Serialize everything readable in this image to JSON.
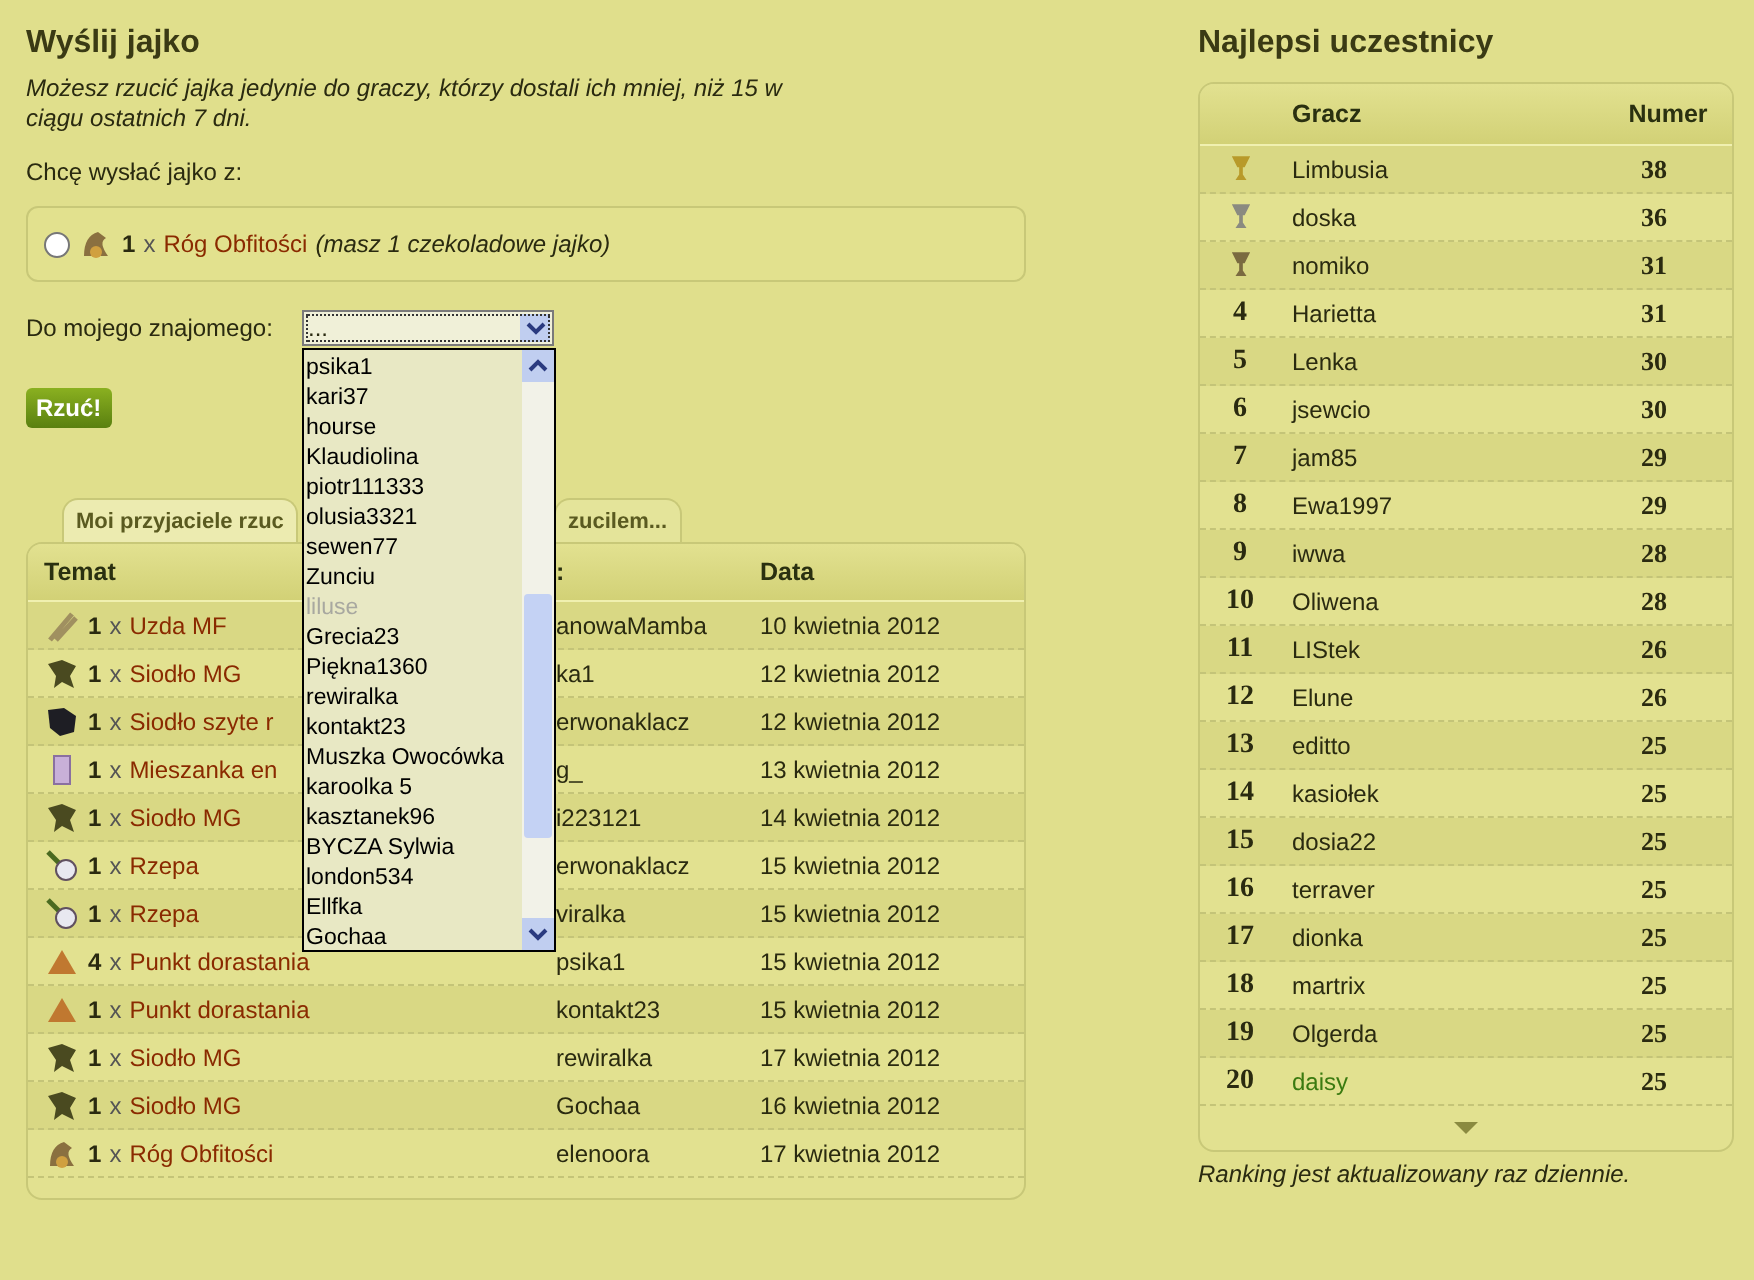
{
  "send": {
    "title": "Wyślij jajko",
    "note": "Możesz rzucić jajka jedynie do graczy, którzy dostali ich mniej, niż 15 w ciągu ostatnich 7 dni.",
    "from_label": "Chcę wysłać jajko z:",
    "option": {
      "selected": false,
      "kind": "horn",
      "qty": "1",
      "x": "x",
      "name": "Róg Obfitości",
      "detail": "(masz 1 czekoladowe jajko)"
    },
    "to_label": "Do mojego znajomego:",
    "select": {
      "value": "...",
      "expanded": true,
      "options": [
        {
          "label": "psika1",
          "disabled": false
        },
        {
          "label": "kari37",
          "disabled": false
        },
        {
          "label": "hourse",
          "disabled": false
        },
        {
          "label": "Klaudiolina",
          "disabled": false
        },
        {
          "label": "piotr111333",
          "disabled": false
        },
        {
          "label": "olusia3321",
          "disabled": false
        },
        {
          "label": "sewen77",
          "disabled": false
        },
        {
          "label": "Zunciu",
          "disabled": false
        },
        {
          "label": "liluse",
          "disabled": true
        },
        {
          "label": "Grecia23",
          "disabled": false
        },
        {
          "label": "Piękna1360",
          "disabled": false
        },
        {
          "label": "rewiralka",
          "disabled": false
        },
        {
          "label": "kontakt23",
          "disabled": false
        },
        {
          "label": "Muszka Owocówka",
          "disabled": false
        },
        {
          "label": "karoolka 5",
          "disabled": false
        },
        {
          "label": "kasztanek96",
          "disabled": false
        },
        {
          "label": "BYCZA Sylwia",
          "disabled": false
        },
        {
          "label": "london534",
          "disabled": false
        },
        {
          "label": "Ellfka",
          "disabled": false
        },
        {
          "label": "Gochaa",
          "disabled": false
        }
      ]
    },
    "button": "Rzuć!"
  },
  "tabs": [
    {
      "label": "Moi przyjaciele rzuc",
      "selected": true
    },
    {
      "label": "zucilem...",
      "selected": false
    }
  ],
  "table": {
    "columns": [
      "Temat",
      ":",
      "Data"
    ],
    "rows": [
      {
        "kind": "bridle",
        "qty": "1",
        "x": "x",
        "name": "Uzda MF",
        "user": "anowaMamba",
        "date": "10 kwietnia 2012"
      },
      {
        "kind": "saddle",
        "qty": "1",
        "x": "x",
        "name": "Siodło MG",
        "user": "ka1",
        "date": "12 kwietnia 2012"
      },
      {
        "kind": "saddle-dark",
        "qty": "1",
        "x": "x",
        "name": "Siodło szyte r",
        "user": "erwonaklacz",
        "date": "12 kwietnia 2012"
      },
      {
        "kind": "mix",
        "qty": "1",
        "x": "x",
        "name": "Mieszanka en",
        "user": "g_",
        "date": "13 kwietnia 2012"
      },
      {
        "kind": "saddle",
        "qty": "1",
        "x": "x",
        "name": "Siodło MG",
        "user": "i223121",
        "date": "14 kwietnia 2012"
      },
      {
        "kind": "radish",
        "qty": "1",
        "x": "x",
        "name": "Rzepa",
        "user": "erwonaklacz",
        "date": "15 kwietnia 2012"
      },
      {
        "kind": "radish",
        "qty": "1",
        "x": "x",
        "name": "Rzepa",
        "user": "viralka",
        "date": "15 kwietnia 2012"
      },
      {
        "kind": "pyramid",
        "qty": "4",
        "x": "x",
        "name": "Punkt dorastania",
        "user": "psika1",
        "date": "15 kwietnia 2012"
      },
      {
        "kind": "pyramid",
        "qty": "1",
        "x": "x",
        "name": "Punkt dorastania",
        "user": "kontakt23",
        "date": "15 kwietnia 2012"
      },
      {
        "kind": "saddle",
        "qty": "1",
        "x": "x",
        "name": "Siodło MG",
        "user": "rewiralka",
        "date": "17 kwietnia 2012"
      },
      {
        "kind": "saddle",
        "qty": "1",
        "x": "x",
        "name": "Siodło MG",
        "user": "Gochaa",
        "date": "16 kwietnia 2012"
      },
      {
        "kind": "horn",
        "qty": "1",
        "x": "x",
        "name": "Róg Obfitości",
        "user": "elenoora",
        "date": "17 kwietnia 2012"
      }
    ]
  },
  "ranking": {
    "title": "Najlepsi uczestnicy",
    "columns": [
      "Gracz",
      "Numer"
    ],
    "rows": [
      {
        "kind": "trophy",
        "color": "#b89a2a",
        "name": "Limbusia",
        "score": "38",
        "highlighted": false
      },
      {
        "kind": "trophy",
        "color": "#8a8a80",
        "name": "doska",
        "score": "36",
        "highlighted": false
      },
      {
        "kind": "trophy",
        "color": "#7a6a40",
        "name": "nomiko",
        "score": "31",
        "highlighted": false
      },
      {
        "rank": "4",
        "name": "Harietta",
        "score": "31",
        "highlighted": false
      },
      {
        "rank": "5",
        "name": "Lenka",
        "score": "30",
        "highlighted": false
      },
      {
        "rank": "6",
        "name": "jsewcio",
        "score": "30",
        "highlighted": false
      },
      {
        "rank": "7",
        "name": "jam85",
        "score": "29",
        "highlighted": false
      },
      {
        "rank": "8",
        "name": "Ewa1997",
        "score": "29",
        "highlighted": false
      },
      {
        "rank": "9",
        "name": "iwwa",
        "score": "28",
        "highlighted": false
      },
      {
        "rank": "10",
        "name": "Oliwena",
        "score": "28",
        "highlighted": false
      },
      {
        "rank": "11",
        "name": "LIStek",
        "score": "26",
        "highlighted": false
      },
      {
        "rank": "12",
        "name": "Elune",
        "score": "26",
        "highlighted": false
      },
      {
        "rank": "13",
        "name": "editto",
        "score": "25",
        "highlighted": false
      },
      {
        "rank": "14",
        "name": "kasiołek",
        "score": "25",
        "highlighted": false
      },
      {
        "rank": "15",
        "name": "dosia22",
        "score": "25",
        "highlighted": false
      },
      {
        "rank": "16",
        "name": "terraver",
        "score": "25",
        "highlighted": false
      },
      {
        "rank": "17",
        "name": "dionka",
        "score": "25",
        "highlighted": false
      },
      {
        "rank": "18",
        "name": "martrix",
        "score": "25",
        "highlighted": false
      },
      {
        "rank": "19",
        "name": "Olgerda",
        "score": "25",
        "highlighted": false
      },
      {
        "rank": "20",
        "name": "daisy",
        "score": "25",
        "highlighted": true
      }
    ],
    "caption": "Ranking jest aktualizowany raz dziennie."
  }
}
